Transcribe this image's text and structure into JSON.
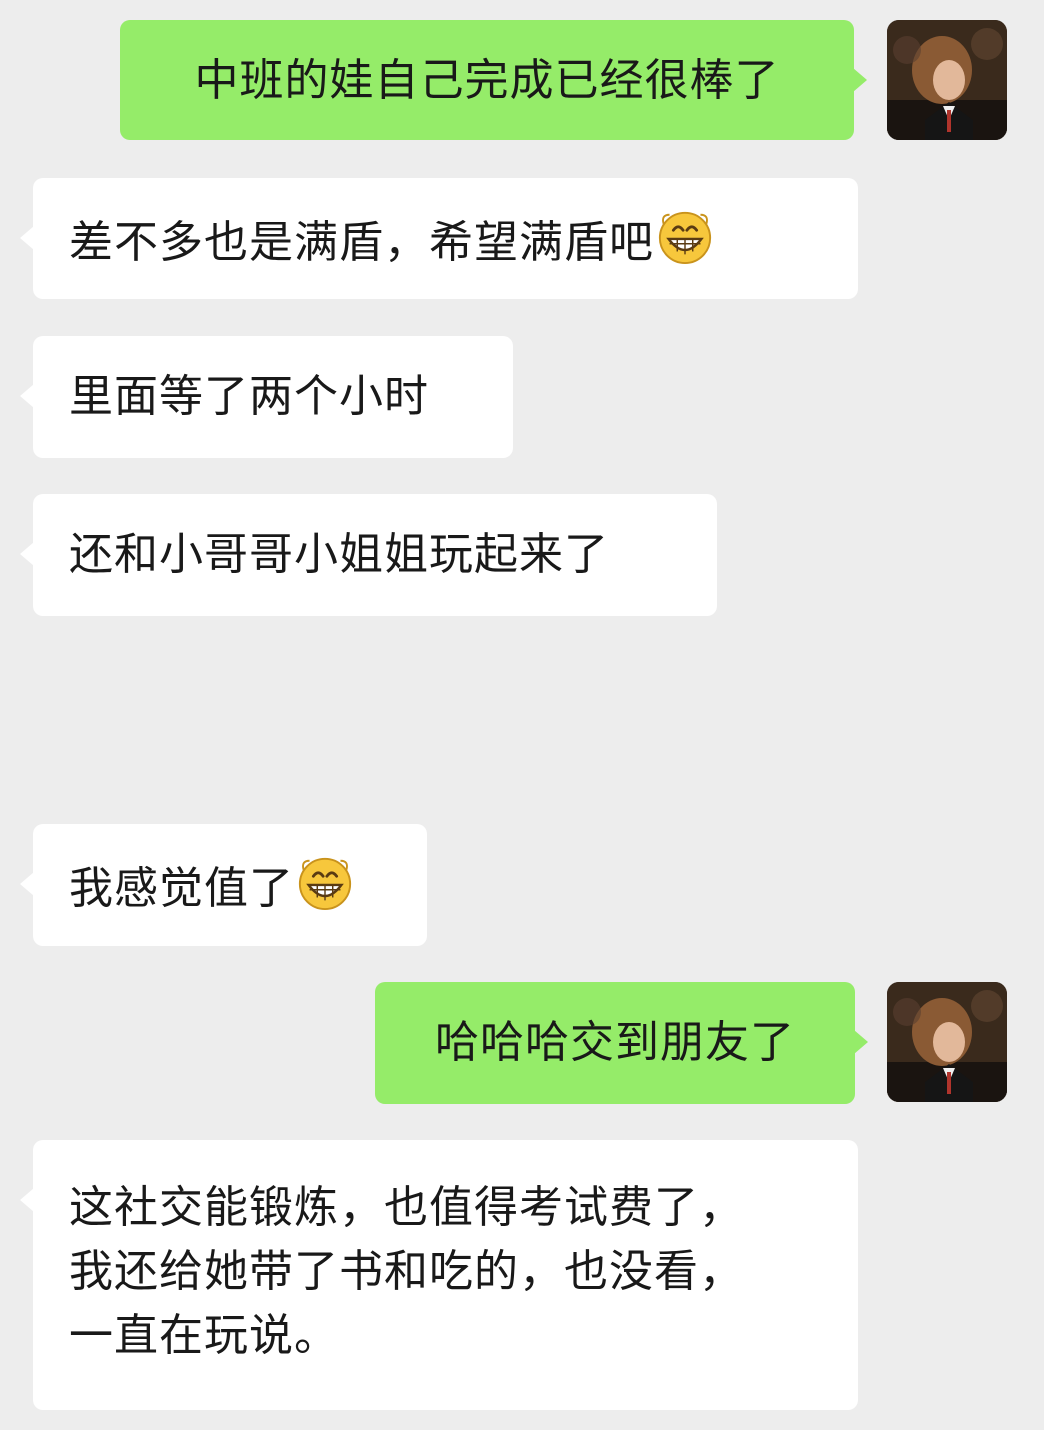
{
  "messages": [
    {
      "side": "out",
      "text": "中班的娃自己完成已经很棒了",
      "avatar": "user-avatar"
    },
    {
      "side": "in",
      "text": "差不多也是满盾，希望满盾吧",
      "emoji": "grin-emoji"
    },
    {
      "side": "in",
      "text": "里面等了两个小时"
    },
    {
      "side": "in",
      "text": "还和小哥哥小姐姐玩起来了"
    },
    {
      "side": "in",
      "text": "我感觉值了",
      "emoji": "grin-emoji"
    },
    {
      "side": "out",
      "text": "哈哈哈交到朋友了",
      "avatar": "user-avatar"
    },
    {
      "side": "in",
      "lines": [
        "这社交能锻炼，也值得考试费了，",
        "我还给她带了书和吃的，也没看，",
        "一直在玩说。"
      ]
    }
  ],
  "colors": {
    "background": "#ededed",
    "outgoing_bubble": "#95ec69",
    "incoming_bubble": "#ffffff",
    "text": "#191919"
  }
}
